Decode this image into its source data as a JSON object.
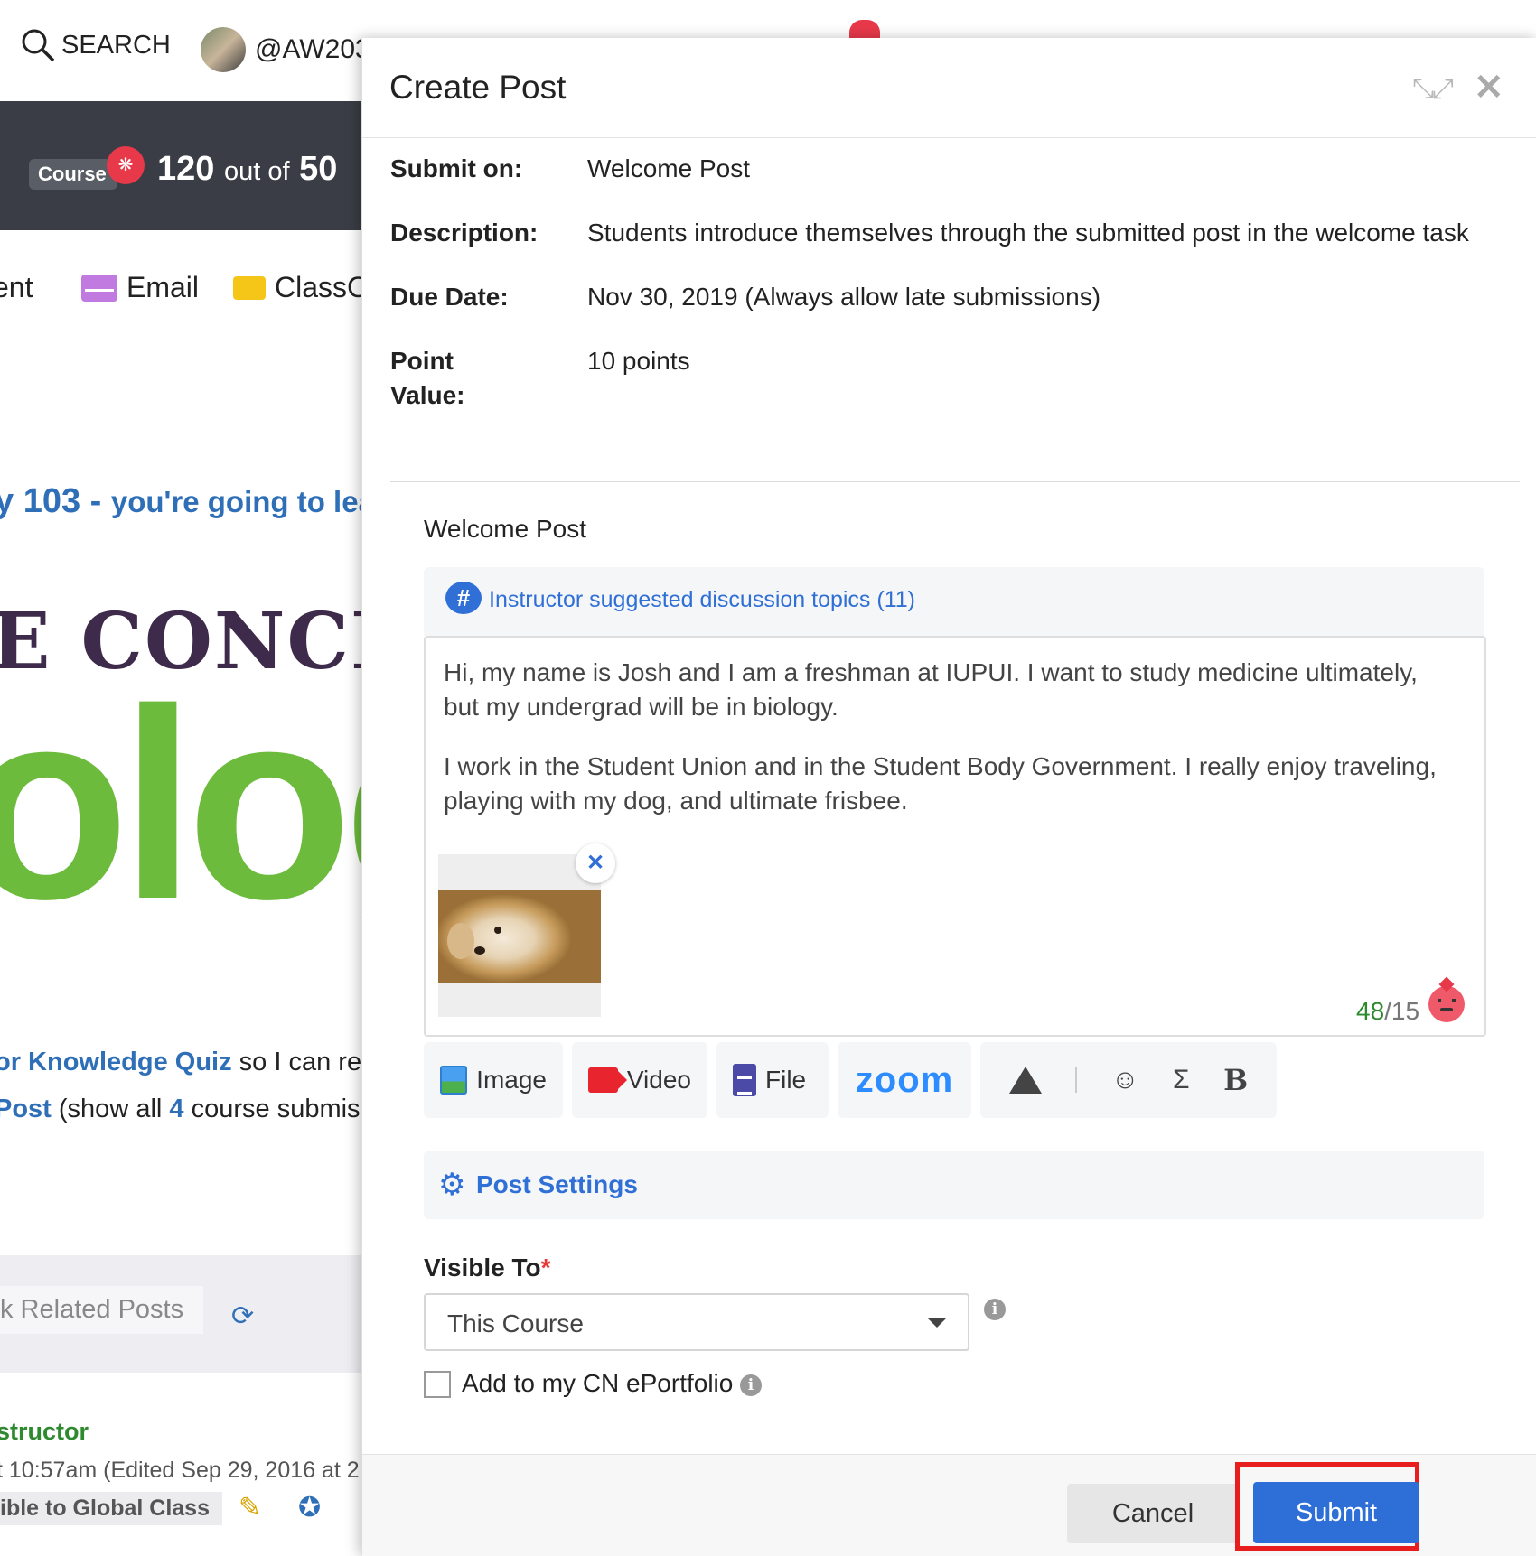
{
  "background": {
    "search_label": "SEARCH",
    "user_handle": "@AW203",
    "course_pill": "Course",
    "score_value": "120",
    "score_of": "out of",
    "score_total": "50",
    "nav_partial": "ent",
    "nav_email": "Email",
    "nav_class": "ClassC",
    "course_title_num": "y 103 -",
    "course_title_rest": "you're going to lea",
    "banner_text": "E CONCEP",
    "banner_big": "olog",
    "quiz_link": "or Knowledge Quiz",
    "quiz_rest": " so I can rev",
    "post_link": "Post",
    "post_rest_a": " (show all ",
    "post_count": "4",
    "post_rest_b": " course submiss",
    "related_label": "k Related Posts",
    "instructor_label": "structor",
    "edited_text": "t 10:57am (Edited Sep 29, 2016 at 2",
    "visible_text": "ible to Global Class"
  },
  "modal": {
    "title": "Create Post",
    "details": [
      {
        "label": "Submit on:",
        "value": "Welcome Post"
      },
      {
        "label": "Description:",
        "value": "Students introduce themselves through the submitted post in the welcome task"
      },
      {
        "label": "Due Date:",
        "value": "Nov 30, 2019 (Always allow late submissions)"
      },
      {
        "label": "Point Value:",
        "value": "10 points"
      }
    ],
    "post_title": "Welcome Post",
    "topics_link": "Instructor suggested discussion topics (11)",
    "editor": {
      "paragraph1": "Hi, my name is Josh and I am a freshman at IUPUI. I want to study medicine ultimately, but my undergrad will be in biology.",
      "paragraph2": "I work in the Student Union and in the Student Body Government. I really enjoy traveling, playing with my dog, and ultimate frisbee.",
      "word_count": "48",
      "word_goal": "/15"
    },
    "toolbar": {
      "image": "Image",
      "video": "Video",
      "file": "File",
      "zoom": "zoom",
      "sigma": "Σ",
      "bold": "B"
    },
    "settings_label": "Post Settings",
    "visible_to_label": "Visible To",
    "required_mark": "*",
    "visible_to_value": "This Course",
    "eportfolio_label": "Add to my CN ePortfolio",
    "cancel_label": "Cancel",
    "submit_label": "Submit"
  },
  "colors": {
    "accent": "#2d6fd6",
    "highlight_frame": "#e81e1e",
    "counter_green": "#2e8a2e"
  }
}
